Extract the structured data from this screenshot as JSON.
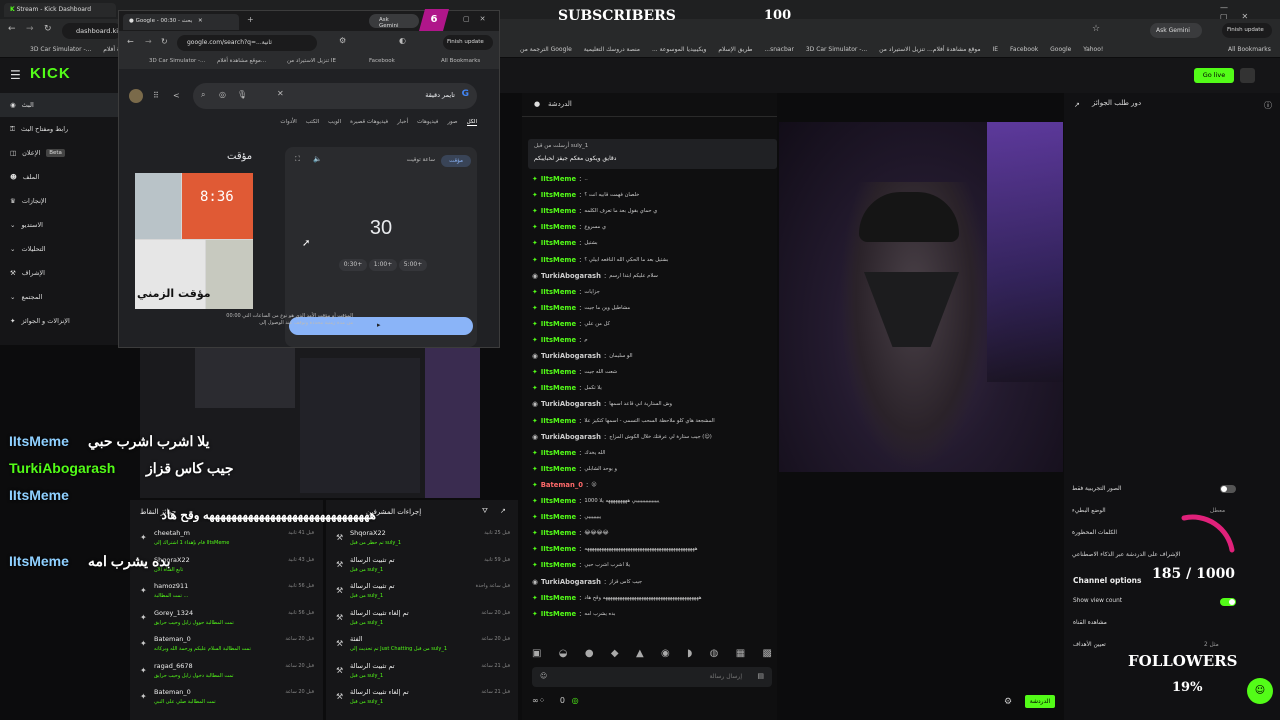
{
  "back_browser": {
    "tab_title": "Stream - Kick Dashboard",
    "url": "dashboard.ki",
    "ask_gemini": "Ask Gemini",
    "finish_update": "Finish update",
    "bookmarks": [
      "3D Car Simulator -...",
      "موقع مشاهدة أفلام...",
      "تنزيل الاستيراد من IE",
      "Facebook",
      "Google",
      "Yahoo!",
      "3D Car Simulator -...",
      "...snacbar",
      "منصة دروسك التعليمية",
      "ويكيبيديا الموسوعة ...",
      "طريق الإسلام",
      "الترجمة من Google"
    ],
    "all_bookmarks": "All Bookmarks"
  },
  "kick": {
    "logo": "KICK",
    "go_live": "Go live",
    "sidebar": [
      {
        "label": "البث",
        "icon": "broadcast-icon",
        "active": true
      },
      {
        "label": "رابط ومفتاح البث",
        "icon": "key-icon"
      },
      {
        "label": "الإعلان",
        "icon": "megaphone-icon",
        "badge": "Beta"
      },
      {
        "label": "الملف",
        "icon": "user-icon"
      },
      {
        "label": "الإنجازات",
        "icon": "trophy-icon"
      },
      {
        "label": "الاستديو",
        "icon": "chevron-down-icon"
      },
      {
        "label": "التحليلات",
        "icon": "chevron-down-icon"
      },
      {
        "label": "الإشراف",
        "icon": "hammer-icon"
      },
      {
        "label": "المجتمع",
        "icon": "chevron-down-icon"
      },
      {
        "label": "الإنزالات و الجوائز",
        "icon": "gift-icon"
      }
    ]
  },
  "google_window": {
    "tab_title": "Google - بحث - 00:30",
    "url": "google.com/search?q=...ثانية",
    "ask_gemini": "Ask Gemini",
    "notif": "6",
    "finish_update": "Finish update",
    "bookmarks": [
      "3D Car Simulator -...",
      "موقع مشاهدة أفلام...",
      "تنزيل الاستيراد من IE",
      "Facebook"
    ],
    "all_bookmarks": "All Bookmarks",
    "query": "تايمر دقيقة",
    "tabs": [
      "الكل",
      "صور",
      "فيديوهات",
      "أخبار",
      "فيديوهات قصيرة",
      "الويب",
      "الكتب",
      "الأدوات"
    ],
    "timer_label": "مؤقت",
    "timer_tab": "مؤقت",
    "stopwatch_tab": "ساعة توقيت",
    "timer_value": "30",
    "buttons": [
      "0:30+",
      "1:00+",
      "5:00+"
    ],
    "image_caption": "مؤقت الزمني",
    "image_text": "8:36",
    "desc": "المؤقت أو مؤقت الأمد الذي هو نوع من الساعات التي 00:00 من مدة زمنية محددة وتوقف عند الوصول إلى"
  },
  "chat": {
    "title": "الدردشة",
    "pinned_by": "أرسلت من قبل suly_1",
    "pinned_text": "دقايق ويكون معكم جيفز لحبايبكم",
    "messages": [
      {
        "user": "IItsMeme",
        "msg": "..",
        "style": "g"
      },
      {
        "user": "IItsMeme",
        "msg": "خلصان فهمت قابيه انت ؟",
        "style": "g"
      },
      {
        "user": "IItsMeme",
        "msg": "ي حماي بقول بعد ما تعرف الكلمه",
        "style": "g"
      },
      {
        "user": "IItsMeme",
        "msg": "ي مسروع",
        "style": "g"
      },
      {
        "user": "IItsMeme",
        "msg": "بشتيل",
        "style": "g"
      },
      {
        "user": "IItsMeme",
        "msg": "بشتيل بعد ما الحكي الله النافعه ابيلي ؟",
        "style": "g"
      },
      {
        "user": "TurkiAbogarash",
        "msg": "سلام عليكم ابتدا ارسم",
        "style": "t"
      },
      {
        "user": "IItsMeme",
        "msg": "جزايات",
        "style": "g"
      },
      {
        "user": "IItsMeme",
        "msg": "مشاطيل وين ما جيت",
        "style": "g"
      },
      {
        "user": "IItsMeme",
        "msg": "كل من علي",
        "style": "g"
      },
      {
        "user": "IItsMeme",
        "msg": "م",
        "style": "g"
      },
      {
        "user": "TurkiAbogarash",
        "msg": "الو سليمان",
        "style": "t"
      },
      {
        "user": "IItsMeme",
        "msg": "شعت الله جيت",
        "style": "g"
      },
      {
        "user": "IItsMeme",
        "msg": "يلا تكمل",
        "style": "g"
      },
      {
        "user": "TurkiAbogarash",
        "msg": "وش الستارية اني قاعد اسمها",
        "style": "t"
      },
      {
        "user": "IItsMeme",
        "msg": "المشجعة هاي كلو ملاحظة السحب التسمى - اسمها كتكيز علا",
        "style": "g"
      },
      {
        "user": "TurkiAbogarash",
        "msg": "جيب ستارة لي عرفتك خلال الكوش المزاج (😊)",
        "style": "t"
      },
      {
        "user": "IItsMeme",
        "msg": "الله يخدك",
        "style": "g"
      },
      {
        "user": "IItsMeme",
        "msg": "و يوحد الشابلي",
        "style": "g"
      },
      {
        "user": "Bateman_0",
        "msg": "😮",
        "style": "b"
      },
      {
        "user": "IItsMeme",
        "msg": "يييييييييييييييي هههههههههه يلا 1000",
        "style": "g"
      },
      {
        "user": "IItsMeme",
        "msg": "ييييييييي",
        "style": "g"
      },
      {
        "user": "IItsMeme",
        "msg": "😂😂😂😂",
        "style": "g"
      },
      {
        "user": "IItsMeme",
        "msg": "ههههههههههههههههههههههههههههههههههههههههههههههه",
        "style": "g"
      },
      {
        "user": "IItsMeme",
        "msg": "يلا اشرب اشرب حبي",
        "style": "g"
      },
      {
        "user": "TurkiAbogarash",
        "msg": "جيب كاس قزاز",
        "style": "t"
      },
      {
        "user": "IItsMeme",
        "msg": "ههههههههههههههههههههههههههههههههههههههههه وقح هاد",
        "style": "g"
      },
      {
        "user": "IItsMeme",
        "msg": "بده يشرب امه",
        "style": "g"
      }
    ],
    "input_placeholder": "إرسال رسالة",
    "viewers": "0",
    "send_label": "الدردشة"
  },
  "right_panel": {
    "title": "دور طلب الجوائز",
    "rows": [
      {
        "label": "الصور التجريبية فقط",
        "toggle": false
      },
      {
        "label": "الوضع البطيء",
        "value": "معطل"
      },
      {
        "label": "الكلمات المحظورة"
      },
      {
        "label": "الإشراف على الدردشة عبر الذكاء الاصطناعي"
      }
    ],
    "channel_options": "Channel options",
    "show_view_count": "Show view count",
    "channel_link": "مشاهدة القناة",
    "goals": "تعيين الأهداف",
    "goals_value": "مثل 2"
  },
  "overlays": {
    "subscribers_label": "SUBSCRIBERS",
    "subscribers_value": "100",
    "followers_label": "FOLLOWERS",
    "followers_count": "185 / 1000",
    "followers_pct": "19%",
    "followers_progress": 0.19,
    "chat": [
      {
        "user": "IItsMeme",
        "msg": "يلا اشرب اشرب حبي",
        "color": "#8fd0ff"
      },
      {
        "user": "TurkiAbogarash",
        "msg": "جيب كاس قزاز",
        "color": "#53fc18"
      },
      {
        "user": "IItsMeme",
        "msg": "ههههههههههههههههههههههههههههههه وقح هاد",
        "color": "#8fd0ff"
      },
      {
        "user": "IItsMeme",
        "msg": "بده يشرب امه",
        "color": "#8fd0ff"
      }
    ]
  },
  "rewards_panel": {
    "title": "جوائز النقاط",
    "items": [
      {
        "user": "cheetah_m",
        "detail": "قام بإهداء 1 اشتراك إلى IItsMeme",
        "time": "قبل 41 ثانية"
      },
      {
        "user": "ShqoraX22",
        "detail": "تابع القناة الآن",
        "time": "قبل 43 ثانية"
      },
      {
        "user": "hamoz911",
        "detail": "تمت المطالبة ...",
        "time": "قبل 56 ثانية"
      },
      {
        "user": "Gorey_1324",
        "detail": "تمت المطالبة حوول زايل وحيب حرايق",
        "time": "قبل 56 ثانية"
      },
      {
        "user": "Bateman_0",
        "detail": "تمت المطالبة السلام عليكم ورحمة الله وبركاته",
        "time": "قبل 20 ساعة"
      },
      {
        "user": "ragad_6678",
        "detail": "تمت المطالبة دخول زايل وحيب حرايق",
        "time": "قبل 20 ساعة"
      },
      {
        "user": "Bateman_0",
        "detail": "تمت المطالبة صلي على النبي",
        "time": "قبل 20 ساعة"
      }
    ]
  },
  "mod_panel": {
    "title": "إجراءات المشرفين",
    "items": [
      {
        "user": "ShqoraX22",
        "detail": "تم حظر من قبل suly_1",
        "time": "قبل 25 ثانية"
      },
      {
        "user": "تم تثبيت الرسالة",
        "detail": "من قبل suly_1",
        "time": "قبل 59 ثانية"
      },
      {
        "user": "تم تثبيت الرسالة",
        "detail": "من قبل suly_1",
        "time": "قبل ساعة واحدة"
      },
      {
        "user": "تم إلغاء تثبيت الرسالة",
        "detail": "من قبل suly_1",
        "time": "قبل 20 ساعة"
      },
      {
        "user": "الفئة",
        "detail": "تم تحديث إلى Just Chatting من قبل suly_1",
        "time": "قبل 20 ساعة"
      },
      {
        "user": "تم تثبيت الرسالة",
        "detail": "من قبل suly_1",
        "time": "قبل 21 ساعة"
      },
      {
        "user": "تم إلغاء تثبيت الرسالة",
        "detail": "من قبل suly_1",
        "time": "قبل 21 ساعة"
      }
    ]
  },
  "colors": {
    "kick_green": "#53fc18",
    "bg": "#0c0c0d",
    "panel": "#161618"
  }
}
